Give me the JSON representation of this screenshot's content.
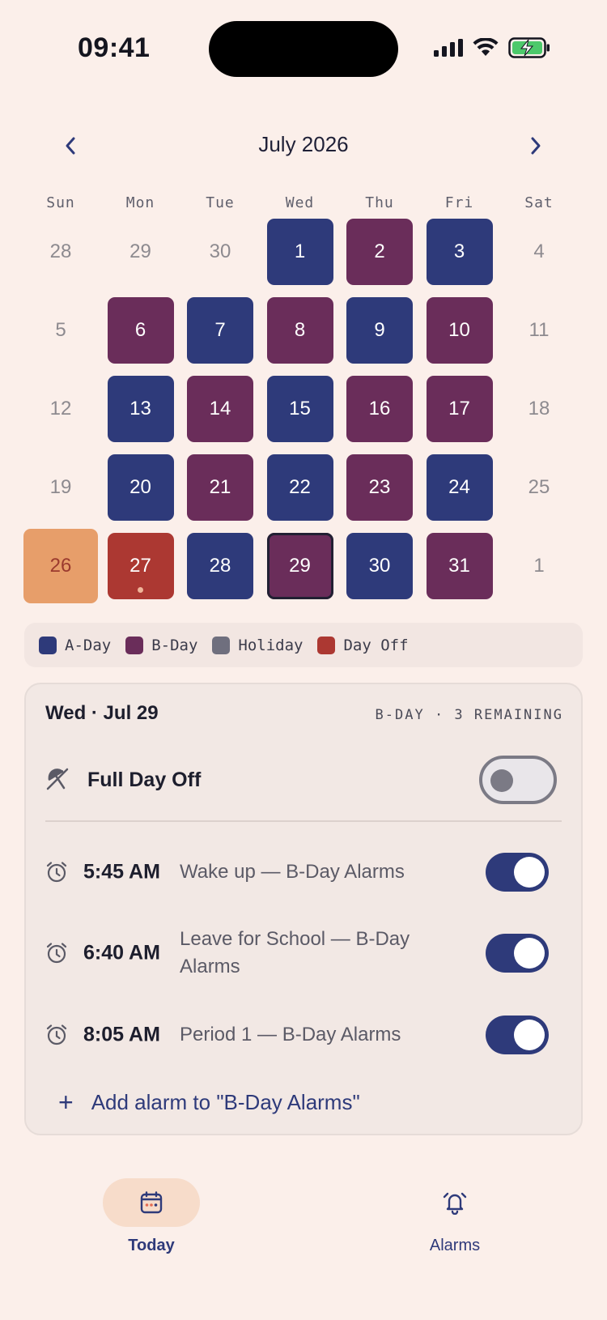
{
  "status_bar": {
    "time": "09:41",
    "icons": [
      "signal-icon",
      "wifi-icon",
      "battery-charging-icon"
    ]
  },
  "calendar": {
    "month_title": "July 2026",
    "prev_icon": "chevron-left-icon",
    "next_icon": "chevron-right-icon",
    "weekdays": [
      "Sun",
      "Mon",
      "Tue",
      "Wed",
      "Thu",
      "Fri",
      "Sat"
    ],
    "weeks": [
      [
        {
          "d": "28",
          "t": "out"
        },
        {
          "d": "29",
          "t": "out"
        },
        {
          "d": "30",
          "t": "out"
        },
        {
          "d": "1",
          "t": "a"
        },
        {
          "d": "2",
          "t": "b"
        },
        {
          "d": "3",
          "t": "a"
        },
        {
          "d": "4",
          "t": "weekend"
        }
      ],
      [
        {
          "d": "5",
          "t": "weekend"
        },
        {
          "d": "6",
          "t": "b"
        },
        {
          "d": "7",
          "t": "a"
        },
        {
          "d": "8",
          "t": "b"
        },
        {
          "d": "9",
          "t": "a"
        },
        {
          "d": "10",
          "t": "b"
        },
        {
          "d": "11",
          "t": "weekend"
        }
      ],
      [
        {
          "d": "12",
          "t": "weekend"
        },
        {
          "d": "13",
          "t": "a"
        },
        {
          "d": "14",
          "t": "b"
        },
        {
          "d": "15",
          "t": "a"
        },
        {
          "d": "16",
          "t": "b"
        },
        {
          "d": "17",
          "t": "b"
        },
        {
          "d": "18",
          "t": "weekend"
        }
      ],
      [
        {
          "d": "19",
          "t": "weekend"
        },
        {
          "d": "20",
          "t": "a"
        },
        {
          "d": "21",
          "t": "b"
        },
        {
          "d": "22",
          "t": "a"
        },
        {
          "d": "23",
          "t": "b"
        },
        {
          "d": "24",
          "t": "a"
        },
        {
          "d": "25",
          "t": "weekend"
        }
      ],
      [
        {
          "d": "26",
          "t": "today"
        },
        {
          "d": "27",
          "t": "off",
          "dot": true
        },
        {
          "d": "28",
          "t": "a"
        },
        {
          "d": "29",
          "t": "b",
          "selected": true
        },
        {
          "d": "30",
          "t": "a"
        },
        {
          "d": "31",
          "t": "b"
        },
        {
          "d": "1",
          "t": "out"
        }
      ]
    ]
  },
  "legend": [
    {
      "label": "A-Day",
      "color": "#2e3a7a"
    },
    {
      "label": "B-Day",
      "color": "#6a2d5a"
    },
    {
      "label": "Holiday",
      "color": "#6f6f7e"
    },
    {
      "label": "Day Off",
      "color": "#ac3832"
    }
  ],
  "detail": {
    "date": "Wed · Jul 29",
    "status": "B-DAY · 3 REMAINING",
    "day_off": {
      "label": "Full Day Off",
      "icon": "umbrella-off-icon",
      "enabled": false
    },
    "alarms": [
      {
        "time": "5:45 AM",
        "label": "Wake up — B-Day Alarms",
        "enabled": true
      },
      {
        "time": "6:40 AM",
        "label": "Leave for School — B-Day Alarms",
        "enabled": true
      },
      {
        "time": "8:05 AM",
        "label": "Period 1 — B-Day Alarms",
        "enabled": true
      }
    ],
    "add_label": "Add alarm to \"B-Day Alarms\""
  },
  "tabs": [
    {
      "label": "Today",
      "icon": "calendar-icon",
      "active": true
    },
    {
      "label": "Alarms",
      "icon": "alarm-bell-icon",
      "active": false
    }
  ],
  "colors": {
    "background": "#fbefea",
    "a_day": "#2e3a7a",
    "b_day": "#6a2d5a",
    "day_off": "#ac3832",
    "today": "#e79e6a"
  }
}
